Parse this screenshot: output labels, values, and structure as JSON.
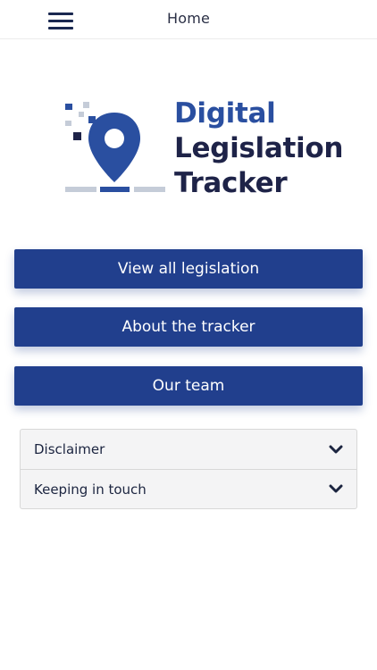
{
  "header": {
    "title": "Home",
    "menu_icon": "hamburger-icon"
  },
  "logo": {
    "line1": "Digital",
    "line2": "Legislation",
    "line3": "Tracker",
    "icon": "map-pin-pixel-icon",
    "colors": {
      "primary": "#2a4fa0",
      "dark": "#1e2348",
      "muted": "#c5ccd8"
    }
  },
  "nav_buttons": [
    {
      "label": "View all legislation"
    },
    {
      "label": "About the tracker"
    },
    {
      "label": "Our team"
    }
  ],
  "accordion": [
    {
      "label": "Disclaimer",
      "icon": "chevron-down-icon"
    },
    {
      "label": "Keeping in touch",
      "icon": "chevron-down-icon"
    }
  ],
  "colors": {
    "button_bg": "#213f8d",
    "button_text": "#ffffff",
    "accordion_bg": "#f4f4f5"
  }
}
